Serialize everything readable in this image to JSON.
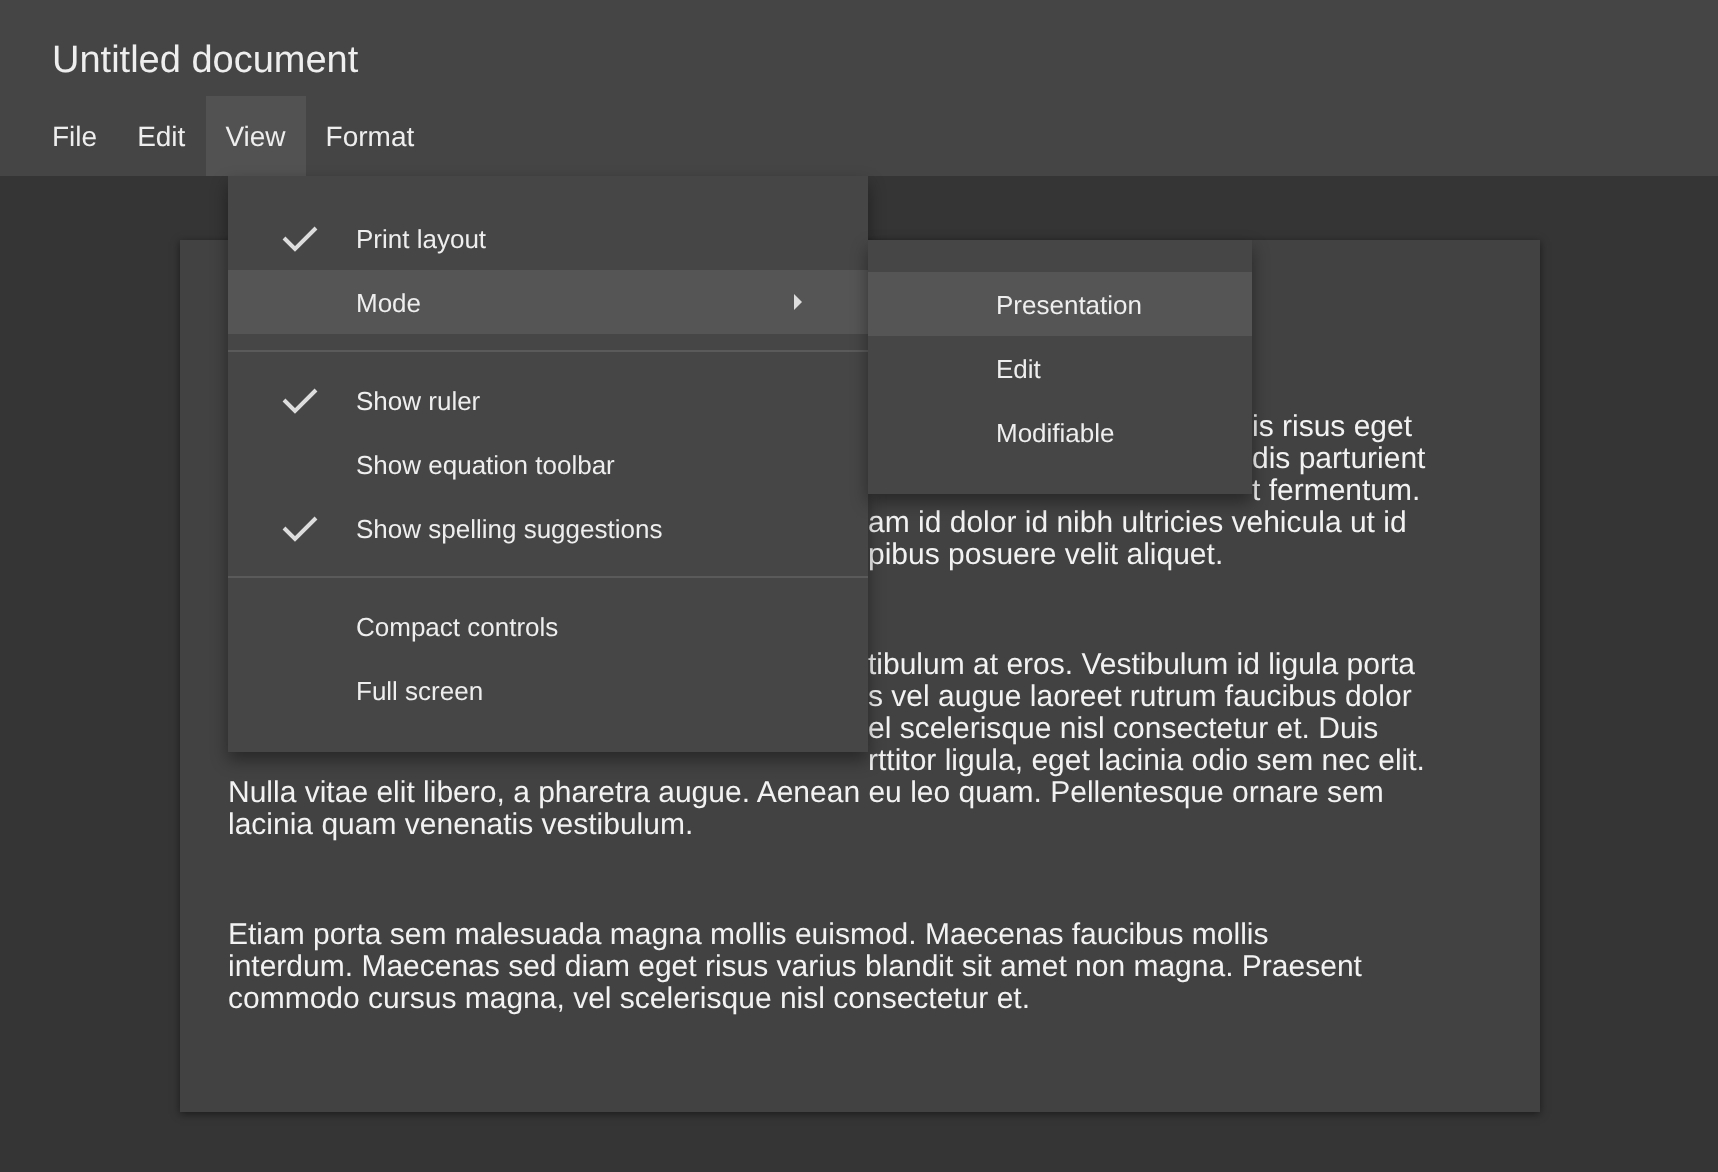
{
  "window": {
    "title": "Untitled document"
  },
  "menu_bar": [
    {
      "label": "File",
      "selected": false
    },
    {
      "label": "Edit",
      "selected": false
    },
    {
      "label": "View",
      "selected": true
    },
    {
      "label": "Format",
      "selected": false
    }
  ],
  "view_menu": {
    "items": [
      {
        "kind": "check",
        "label": "Print layout",
        "checked": true
      },
      {
        "kind": "submenu",
        "label": "Mode",
        "selected": true
      },
      {
        "kind": "divider"
      },
      {
        "kind": "check",
        "label": "Show ruler",
        "checked": true
      },
      {
        "kind": "check",
        "label": "Show equation toolbar",
        "checked": false
      },
      {
        "kind": "check",
        "label": "Show spelling suggestions",
        "checked": true
      },
      {
        "kind": "divider"
      },
      {
        "kind": "check",
        "label": "Compact controls",
        "checked": false
      },
      {
        "kind": "check",
        "label": "Full screen",
        "checked": false
      }
    ]
  },
  "mode_submenu": {
    "items": [
      {
        "label": "Presentation",
        "selected": true
      },
      {
        "label": "Edit",
        "selected": false
      },
      {
        "label": "Modifiable",
        "selected": false
      }
    ]
  },
  "document": {
    "paragraphs": [
      {
        "lines": [
          "is risus eget",
          "dis parturient",
          "t fermentum.",
          "am id dolor id nibh ultricies vehicula ut id",
          "pibus posuere velit aliquet."
        ]
      },
      {
        "lines": [
          "tibulum at eros. Vestibulum id ligula porta",
          "s vel augue laoreet rutrum faucibus dolor",
          "el scelerisque nisl consectetur et. Duis",
          "rttitor ligula, eget lacinia odio sem nec elit.",
          "Nulla vitae elit libero, a pharetra augue. Aenean eu leo quam. Pellentesque ornare sem",
          "lacinia quam venenatis vestibulum."
        ]
      },
      {
        "lines": [
          "Etiam porta sem malesuada magna mollis euismod. Maecenas faucibus mollis",
          "interdum. Maecenas sed diam eget risus varius blandit sit amet non magna. Praesent",
          "commodo cursus magna, vel scelerisque nisl consectetur et."
        ]
      }
    ]
  }
}
